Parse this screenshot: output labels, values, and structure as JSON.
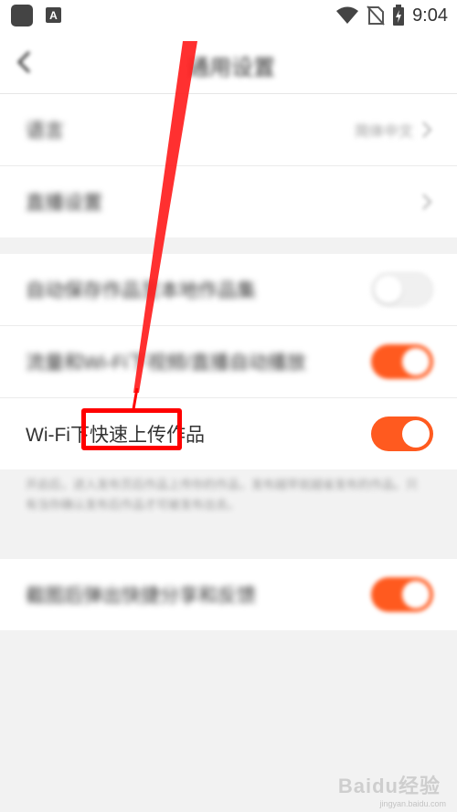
{
  "status_bar": {
    "a_icon_text": "A",
    "time": "9:04",
    "icons": [
      "app-icon",
      "a-icon",
      "wifi-icon",
      "no-sim-icon",
      "battery-charging-icon"
    ]
  },
  "header": {
    "title": "通用设置",
    "back_icon": "chevron-left-icon"
  },
  "group1": {
    "items": [
      {
        "label": "语言",
        "value": "简体中文"
      },
      {
        "label": "直播设置",
        "value": ""
      }
    ]
  },
  "group2": {
    "items": [
      {
        "label": "自动保存作品至本地作品集",
        "toggle": false
      },
      {
        "label": "流量和Wi-Fi下视频/直播自动播放",
        "toggle": true
      },
      {
        "label_prefix": "Wi-Fi下",
        "label_highlight": "快速上传作品",
        "toggle": true
      }
    ],
    "description": "开启后，进入发布页后作品上传你的作品，发布越早就越省发布的作品。只有当你确认发布后作品才可被发布出去。"
  },
  "group3": {
    "items": [
      {
        "label": "截图后弹出快捷分享和反馈",
        "toggle": true
      }
    ]
  },
  "colors": {
    "accent": "#ff5a1f",
    "annotation": "#ff0000",
    "background": "#f2f2f2"
  },
  "watermark": {
    "main": "Baidu经验",
    "sub": "jingyan.baidu.com"
  }
}
